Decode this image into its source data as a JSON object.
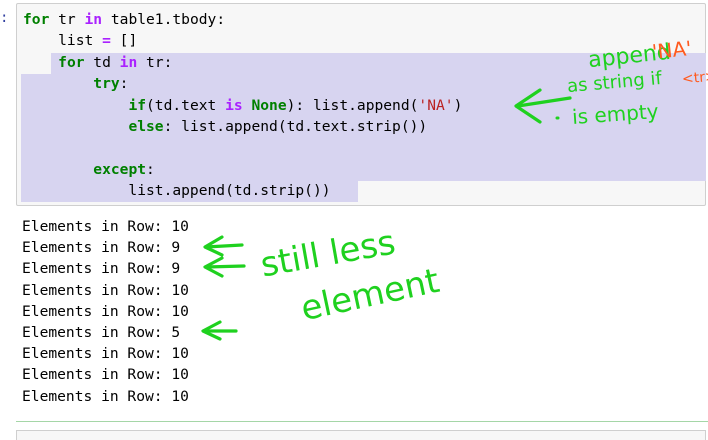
{
  "cell": {
    "prompt": ":",
    "lines": [
      {
        "parts": [
          {
            "t": "for",
            "c": "kw"
          },
          {
            "t": " tr ",
            "c": "nm"
          },
          {
            "t": "in",
            "c": "op"
          },
          {
            "t": " table1.tbody:",
            "c": "nm"
          }
        ]
      },
      {
        "parts": [
          {
            "t": "    list ",
            "c": "nm"
          },
          {
            "t": "=",
            "c": "op"
          },
          {
            "t": " []",
            "c": "nm"
          }
        ]
      },
      {
        "parts": [
          {
            "t": "    ",
            "c": "nm"
          },
          {
            "t": "for",
            "c": "kw"
          },
          {
            "t": " td ",
            "c": "nm"
          },
          {
            "t": "in",
            "c": "op"
          },
          {
            "t": " tr:",
            "c": "nm"
          }
        ]
      },
      {
        "parts": [
          {
            "t": "        ",
            "c": "nm"
          },
          {
            "t": "try",
            "c": "kw"
          },
          {
            "t": ":",
            "c": "nm"
          }
        ]
      },
      {
        "parts": [
          {
            "t": "            ",
            "c": "nm"
          },
          {
            "t": "if",
            "c": "kw"
          },
          {
            "t": "(td.text ",
            "c": "nm"
          },
          {
            "t": "is",
            "c": "op"
          },
          {
            "t": " ",
            "c": "nm"
          },
          {
            "t": "None",
            "c": "kw"
          },
          {
            "t": "): list.append(",
            "c": "nm"
          },
          {
            "t": "'NA'",
            "c": "str"
          },
          {
            "t": ")",
            "c": "nm"
          }
        ]
      },
      {
        "parts": [
          {
            "t": "            ",
            "c": "nm"
          },
          {
            "t": "else",
            "c": "kw"
          },
          {
            "t": ": list.append(td.text.strip())",
            "c": "nm"
          }
        ]
      },
      {
        "parts": [
          {
            "t": " ",
            "c": "nm"
          }
        ]
      },
      {
        "parts": [
          {
            "t": "        ",
            "c": "nm"
          },
          {
            "t": "except",
            "c": "kw"
          },
          {
            "t": ":",
            "c": "nm"
          }
        ]
      },
      {
        "parts": [
          {
            "t": "            list.append(td.strip())",
            "c": "nm"
          }
        ]
      }
    ]
  },
  "output": {
    "lines": [
      "Elements in Row: 10",
      "Elements in Row: 9",
      "Elements in Row: 9",
      "Elements in Row: 10",
      "Elements in Row: 10",
      "Elements in Row: 5",
      "Elements in Row: 10",
      "Elements in Row: 10",
      "Elements in Row: 10"
    ]
  },
  "annotations": {
    "append": "append",
    "na": "'NA'",
    "as_string_if": "as string if",
    "tr_tag": "<tr>",
    "is_empty": "is empty",
    "still_less": "still less",
    "element": "element",
    "ink_green": "#1fd11f",
    "ink_orange": "#ff5a1f",
    "selection_color": "#d7d4f0"
  }
}
